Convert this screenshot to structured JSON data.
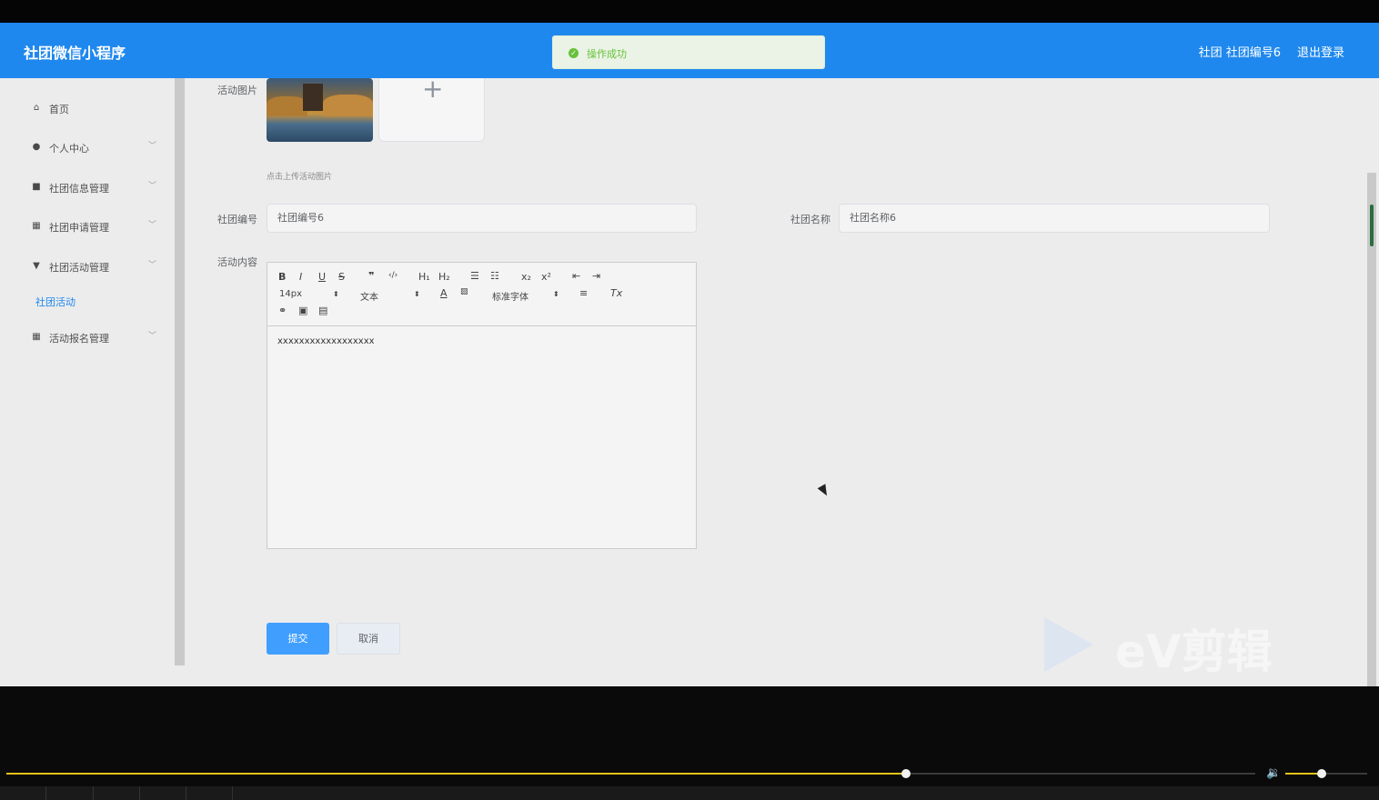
{
  "header": {
    "brand": "社团微信小程序",
    "user": "社团 社团编号6",
    "logout": "退出登录"
  },
  "toast": {
    "text": "操作成功",
    "icon": "check-circle-icon",
    "color": "#67c23a"
  },
  "sidebar": {
    "items": [
      {
        "label": "首页",
        "icon": "home-icon",
        "glyph": "⌂"
      },
      {
        "label": "个人中心",
        "icon": "user-icon",
        "glyph": "●"
      },
      {
        "label": "社团信息管理",
        "icon": "briefcase-icon",
        "glyph": "■"
      },
      {
        "label": "社团申请管理",
        "icon": "grid-icon",
        "glyph": "▦"
      },
      {
        "label": "社团活动管理",
        "icon": "flag-icon",
        "glyph": "▼"
      },
      {
        "label": "活动报名管理",
        "icon": "grid-icon",
        "glyph": "▦"
      }
    ],
    "active_sub": "社团活动",
    "accent": "#1f88ee"
  },
  "form": {
    "image_label": "活动图片",
    "upload_hint": "点击上传活动图片",
    "club_no_label": "社团编号",
    "club_no_value": "社团编号6",
    "club_name_label": "社团名称",
    "club_name_value": "社团名称6",
    "content_label": "活动内容",
    "content_value": "xxxxxxxxxxxxxxxxxx",
    "submit": "提交",
    "cancel": "取消"
  },
  "editor": {
    "font_size": "14px",
    "paragraph": "文本",
    "font_family": "标准字体"
  },
  "watermark": "eV剪辑",
  "player": {
    "progress": 0.72,
    "volume": 0.44
  }
}
